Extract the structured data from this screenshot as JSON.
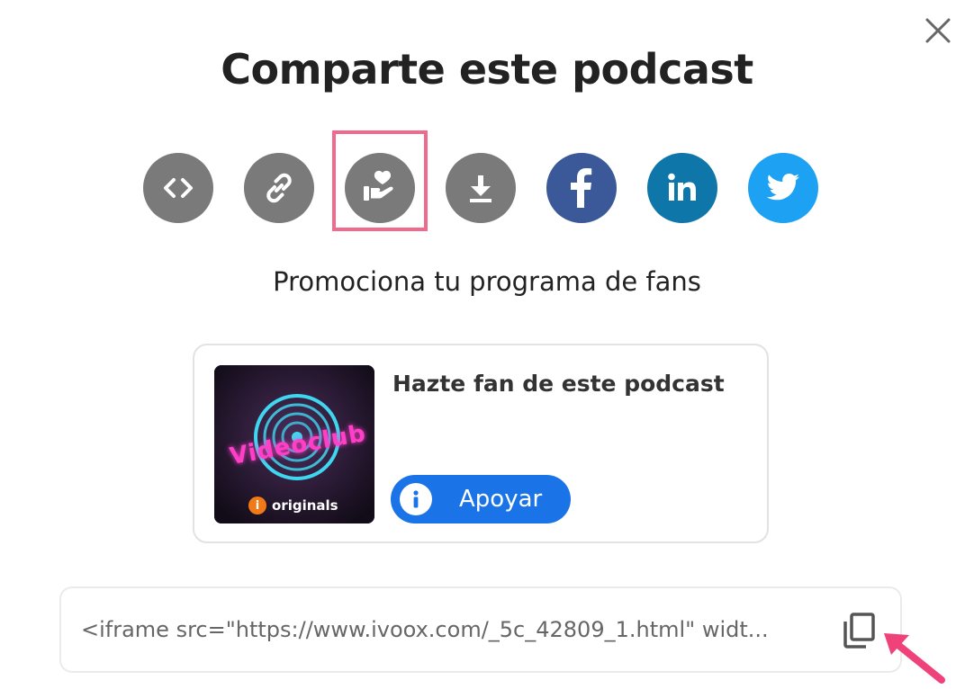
{
  "title": "Comparte este podcast",
  "share_buttons": [
    {
      "name": "embed",
      "icon": "code-icon",
      "color": "#7a7a7a"
    },
    {
      "name": "link",
      "icon": "link-icon",
      "color": "#7a7a7a"
    },
    {
      "name": "fans",
      "icon": "hand-heart-icon",
      "color": "#7a7a7a",
      "selected": true
    },
    {
      "name": "download",
      "icon": "download-icon",
      "color": "#7a7a7a"
    },
    {
      "name": "facebook",
      "icon": "facebook-icon",
      "color": "#3b5998"
    },
    {
      "name": "linkedin",
      "icon": "linkedin-icon",
      "color": "#0e76a8"
    },
    {
      "name": "twitter",
      "icon": "twitter-icon",
      "color": "#1da1f2"
    }
  ],
  "highlight_color": "#f06a8e",
  "subtitle": "Promociona tu programa de fans",
  "fan_card": {
    "cover_logo": "Videoclub",
    "cover_badge": "originals",
    "title": "Hazte fan de este podcast",
    "support_label": "Apoyar",
    "support_color": "#1a74e8"
  },
  "embed": {
    "value": "<iframe src=\"https://www.ivoox.com/_5c_42809_1.html\" widt..."
  },
  "accent_arrow_color": "#f0427a"
}
